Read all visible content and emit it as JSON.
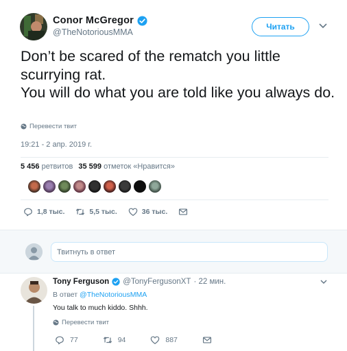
{
  "tweet": {
    "author_name": "Conor McGregor",
    "author_handle": "@TheNotoriousMMA",
    "follow_label": "Читать",
    "text": "Don’t be scared of the rematch you little scurrying rat.\nYou will do what you are told like you always do.",
    "translate_label": "Перевести твит",
    "timestamp": "19:21 - 2 апр. 2019 г.",
    "retweets_count": "5 456",
    "retweets_label": "ретвитов",
    "likes_count": "35 599",
    "likes_label": "отметок «Нравится»",
    "actions": {
      "replies": "1,8 тыс.",
      "retweets": "5,5 тыс.",
      "likes": "36 тыс."
    }
  },
  "reply_box": {
    "placeholder": "Твитнуть в ответ"
  },
  "reply": {
    "author_name": "Tony Ferguson",
    "author_handle": "@TonyFergusonXT",
    "time": "· 22 мин.",
    "reply_to_prefix": "В ответ",
    "reply_to_handle": "@TheNotoriousMMA",
    "text": "You talk to much kiddo. Shhh.",
    "translate_label": "Перевести твит",
    "actions": {
      "replies": "77",
      "retweets": "94",
      "likes": "887"
    }
  },
  "colors": {
    "accent": "#1da1f2",
    "retweet": "#657786",
    "muted": "#657786"
  }
}
